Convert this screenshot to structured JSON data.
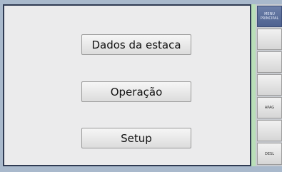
{
  "main_menu": {
    "dados_label": "Dados da estaca",
    "operacao_label": "Operação",
    "setup_label": "Setup"
  },
  "side_menu": {
    "items": [
      {
        "label": "MENU PRINCIPAL",
        "active": true
      },
      {
        "label": ""
      },
      {
        "label": ""
      },
      {
        "label": ""
      },
      {
        "label": "APAG"
      },
      {
        "label": ""
      },
      {
        "label": "DESL"
      }
    ]
  },
  "colors": {
    "background": "#a9b9cc",
    "panel": "#ebebec",
    "active_tab": "#5a6d98",
    "accent_strip": "#b9dfb8"
  }
}
